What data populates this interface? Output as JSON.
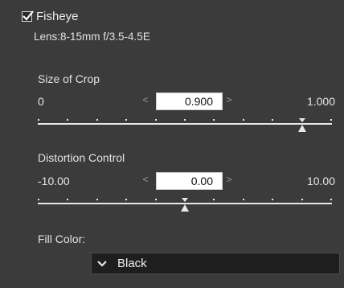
{
  "fisheye": {
    "checkbox_label": "Fisheye",
    "checked": true,
    "lens": "Lens:8-15mm f/3.5-4.5E"
  },
  "size_of_crop": {
    "title": "Size of Crop",
    "min_label": "0",
    "max_label": "1.000",
    "value": "0.900",
    "left_arrow": "<",
    "right_arrow": ">",
    "min": 0,
    "max": 1,
    "numeric_value": 0.9
  },
  "distortion_control": {
    "title": "Distortion Control",
    "min_label": "-10.00",
    "max_label": "10.00",
    "value": "0.00",
    "left_arrow": "<",
    "right_arrow": ">",
    "min": -10,
    "max": 10,
    "numeric_value": 0
  },
  "fill_color": {
    "label": "Fill Color:",
    "selected": "Black",
    "chevron_icon": "chevron-down-icon"
  },
  "colors": {
    "panel_bg": "#3b3b3b",
    "text": "#e2e2e2",
    "value_box_bg": "#ffffff",
    "select_bg": "#1e1e1e"
  }
}
